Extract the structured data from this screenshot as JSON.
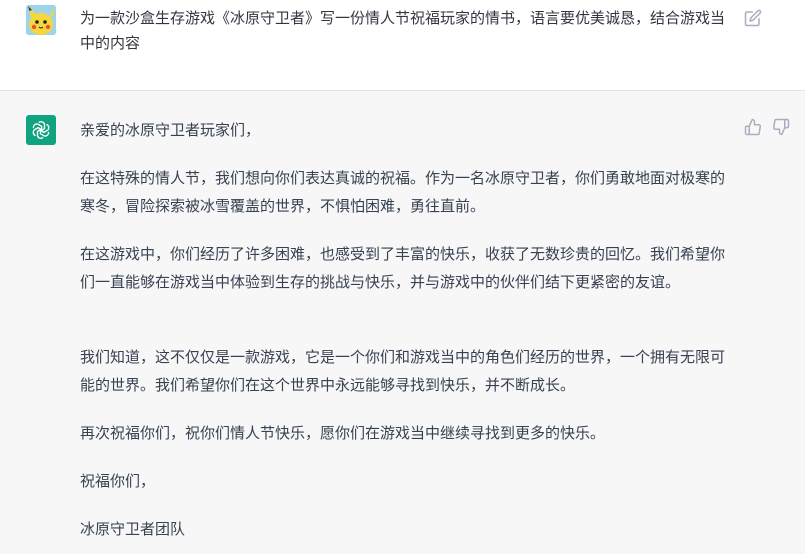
{
  "user_message": {
    "text": "为一款沙盒生存游戏《冰原守卫者》写一份情人节祝福玩家的情书，语言要优美诚恳，结合游戏当中的内容",
    "avatar_icon": "pikachu-avatar-icon",
    "edit_icon": "edit-icon"
  },
  "assistant_message": {
    "avatar_icon": "openai-logo-icon",
    "avatar_color": "#10a37f",
    "paragraphs": [
      "亲爱的冰原守卫者玩家们，",
      "在这特殊的情人节，我们想向你们表达真诚的祝福。作为一名冰原守卫者，你们勇敢地面对极寒的寒冬，冒险探索被冰雪覆盖的世界，不惧怕困难，勇往直前。",
      "在这游戏中，你们经历了许多困难，也感受到了丰富的快乐，收获了无数珍贵的回忆。我们希望你们一直能够在游戏当中体验到生存的挑战与快乐，并与游戏中的伙伴们结下更紧密的友谊。",
      "我们知道，这不仅仅是一款游戏，它是一个你们和游戏当中的角色们经历的世界，一个拥有无限可能的世界。我们希望你们在这个世界中永远能够寻找到快乐，并不断成长。",
      "再次祝福你们，祝你们情人节快乐，愿你们在游戏当中继续寻找到更多的快乐。",
      "祝福你们，",
      "冰原守卫者团队"
    ],
    "feedback_icons": [
      "thumbs-up-icon",
      "thumbs-down-icon"
    ]
  }
}
